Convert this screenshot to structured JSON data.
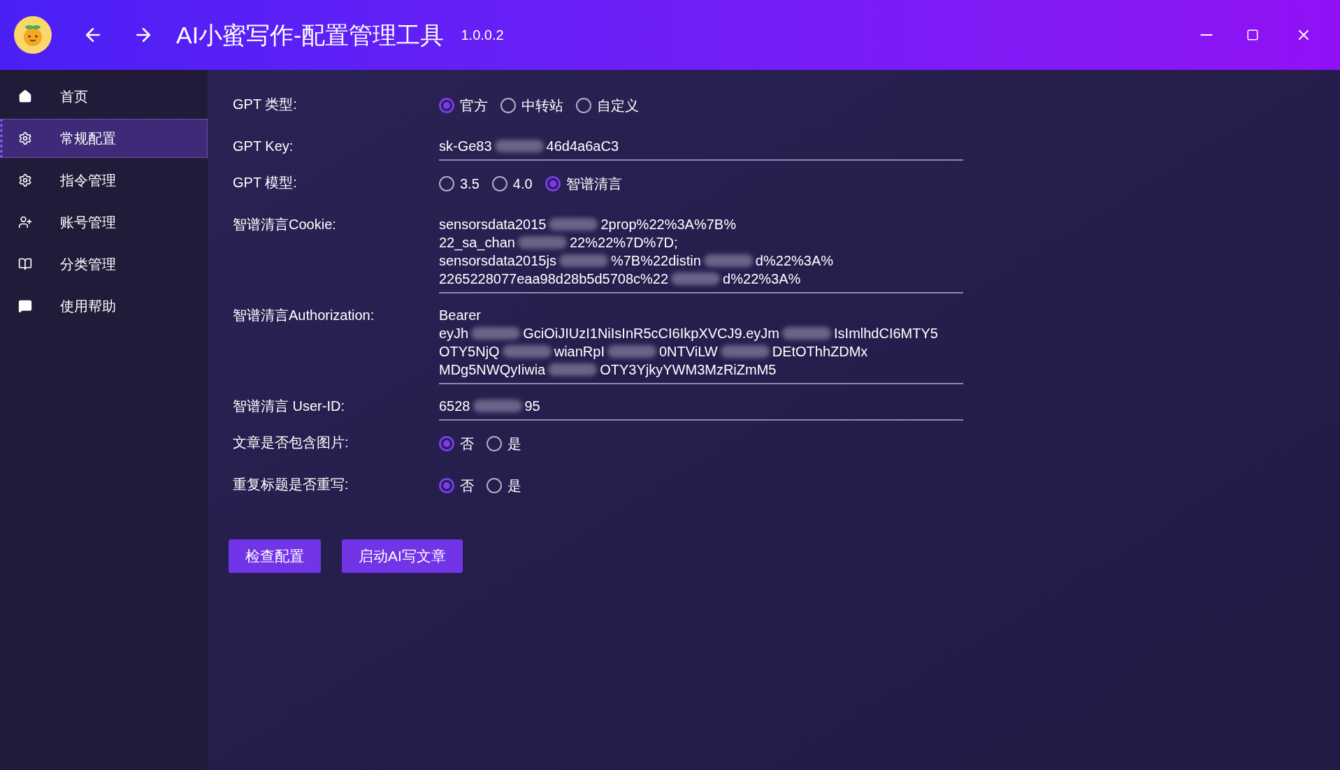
{
  "window": {
    "title": "AI小蜜写作-配置管理工具",
    "version": "1.0.0.2"
  },
  "sidebar": {
    "items": [
      {
        "label": "首页",
        "kind": "home",
        "selected": false
      },
      {
        "label": "常规配置",
        "kind": "gear",
        "selected": true
      },
      {
        "label": "指令管理",
        "kind": "gear",
        "selected": false
      },
      {
        "label": "账号管理",
        "kind": "account",
        "selected": false
      },
      {
        "label": "分类管理",
        "kind": "book",
        "selected": false
      },
      {
        "label": "使用帮助",
        "kind": "help",
        "selected": false
      }
    ]
  },
  "form": {
    "rows": [
      {
        "kind": "radio",
        "label": "GPT 类型:",
        "options": [
          {
            "label": "官方",
            "selected": true
          },
          {
            "label": "中转站",
            "selected": false
          },
          {
            "label": "自定义",
            "selected": false
          }
        ]
      },
      {
        "kind": "field",
        "label": "GPT Key:",
        "lines": [
          [
            "sk-Ge83",
            "46d4a6aC3"
          ]
        ]
      },
      {
        "kind": "radio",
        "label": "GPT 模型:",
        "options": [
          {
            "label": "3.5",
            "selected": false
          },
          {
            "label": "4.0",
            "selected": false
          },
          {
            "label": "智谱清言",
            "selected": true
          }
        ]
      },
      {
        "kind": "field",
        "label": "智谱清言Cookie:",
        "lines": [
          [
            "sensorsdata2015",
            "2prop%22%3A%7B%"
          ],
          [
            "22_sa_chan",
            "22%22%7D%7D;"
          ],
          [
            "sensorsdata2015js",
            "%7B%22distin",
            "d%22%3A%"
          ],
          [
            "2265228077eaa98d28b5d5708c%22",
            "d%22%3A%"
          ]
        ]
      },
      {
        "kind": "field",
        "label": "智谱清言Authorization:",
        "lines": [
          [
            "Bearer"
          ],
          [
            "eyJh",
            "GciOiJIUzI1NiIsInR5cCI6IkpXVCJ9.eyJm",
            "IsImlhdCI6MTY5"
          ],
          [
            "OTY5NjQ",
            "wianRpI",
            "0NTViLW",
            "DEtOThhZDMx"
          ],
          [
            "MDg5NWQyIiwia",
            "OTY3YjkyYWM3MzRiZmM5"
          ]
        ]
      },
      {
        "kind": "field",
        "label": "智谱清言 User-ID:",
        "lines": [
          [
            "6528",
            "95"
          ]
        ]
      },
      {
        "kind": "radio",
        "label": "文章是否包含图片:",
        "options": [
          {
            "label": "否",
            "selected": true
          },
          {
            "label": "是",
            "selected": false
          }
        ]
      },
      {
        "kind": "radio",
        "label": "重复标题是否重写:",
        "options": [
          {
            "label": "否",
            "selected": true
          },
          {
            "label": "是",
            "selected": false
          }
        ]
      }
    ]
  },
  "buttons": [
    "检查配置",
    "启动AI写文章"
  ]
}
